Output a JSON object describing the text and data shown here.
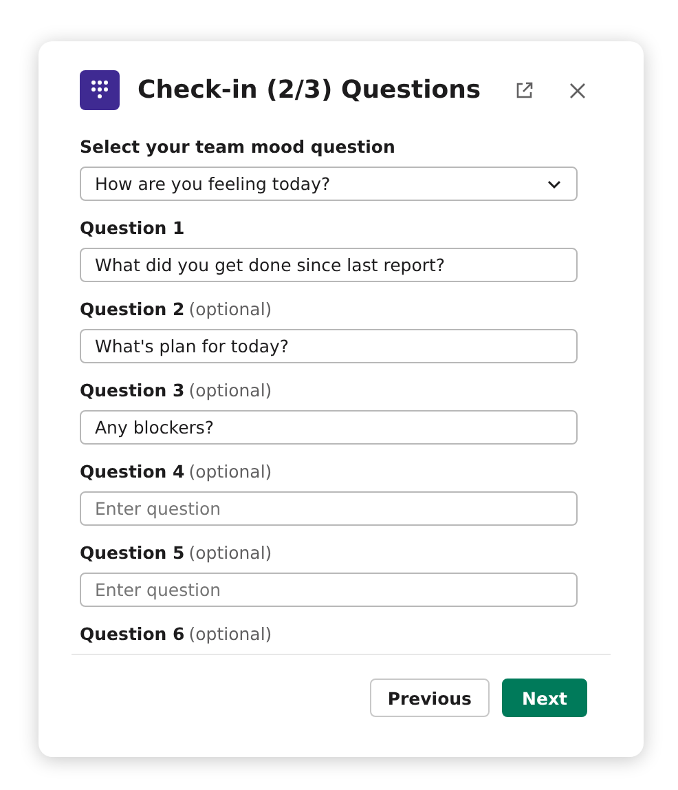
{
  "dialog": {
    "title": "Check-in (2/3) Questions"
  },
  "mood_select": {
    "label": "Select your team mood question",
    "value": "How are you feeling today?"
  },
  "questions": [
    {
      "label": "Question 1",
      "value": "What did you get done since last report?"
    },
    {
      "label": "Question 2",
      "note": "(optional)",
      "value": "What's plan for today?"
    },
    {
      "label": "Question 3",
      "note": "(optional)",
      "value": "Any blockers?"
    },
    {
      "label": "Question 4",
      "note": "(optional)",
      "placeholder": "Enter question"
    },
    {
      "label": "Question 5",
      "note": "(optional)",
      "placeholder": "Enter question"
    },
    {
      "label": "Question 6",
      "note": "(optional)"
    }
  ],
  "buttons": [
    {
      "label": "Previous",
      "kind": "secondary"
    },
    {
      "label": "Next",
      "kind": "primary"
    }
  ]
}
